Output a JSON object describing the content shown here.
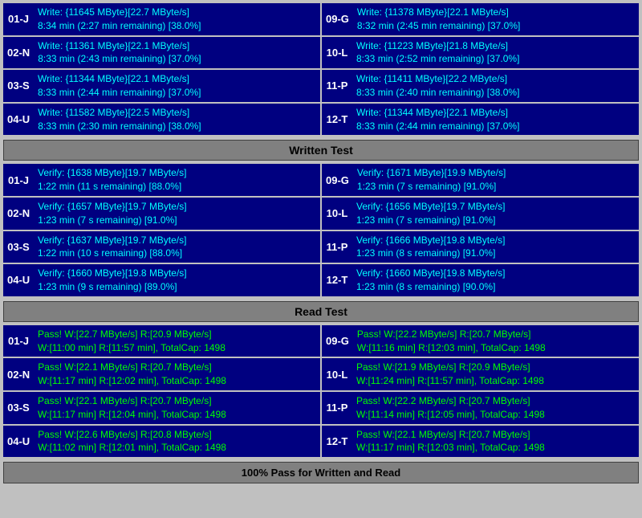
{
  "written_test": {
    "label": "Written Test",
    "rows_left": [
      {
        "id": "01-J",
        "line1": "Write: {11645 MByte}[22.7 MByte/s]",
        "line2": "8:34 min (2:27 min remaining)  [38.0%]"
      },
      {
        "id": "02-N",
        "line1": "Write: {11361 MByte}[22.1 MByte/s]",
        "line2": "8:33 min (2:43 min remaining)  [37.0%]"
      },
      {
        "id": "03-S",
        "line1": "Write: {11344 MByte}[22.1 MByte/s]",
        "line2": "8:33 min (2:44 min remaining)  [37.0%]"
      },
      {
        "id": "04-U",
        "line1": "Write: {11582 MByte}[22.5 MByte/s]",
        "line2": "8:33 min (2:30 min remaining)  [38.0%]"
      }
    ],
    "rows_right": [
      {
        "id": "09-G",
        "line1": "Write: {11378 MByte}[22.1 MByte/s]",
        "line2": "8:32 min (2:45 min remaining)  [37.0%]"
      },
      {
        "id": "10-L",
        "line1": "Write: {11223 MByte}[21.8 MByte/s]",
        "line2": "8:33 min (2:52 min remaining)  [37.0%]"
      },
      {
        "id": "11-P",
        "line1": "Write: {11411 MByte}[22.2 MByte/s]",
        "line2": "8:33 min (2:40 min remaining)  [38.0%]"
      },
      {
        "id": "12-T",
        "line1": "Write: {11344 MByte}[22.1 MByte/s]",
        "line2": "8:33 min (2:44 min remaining)  [37.0%]"
      }
    ]
  },
  "verify_test": {
    "label": "Written Test",
    "rows_left": [
      {
        "id": "01-J",
        "line1": "Verify: {1638 MByte}[19.7 MByte/s]",
        "line2": "1:22 min (11 s remaining)  [88.0%]"
      },
      {
        "id": "02-N",
        "line1": "Verify: {1657 MByte}[19.7 MByte/s]",
        "line2": "1:23 min (7 s remaining)  [91.0%]"
      },
      {
        "id": "03-S",
        "line1": "Verify: {1637 MByte}[19.7 MByte/s]",
        "line2": "1:22 min (10 s remaining)  [88.0%]"
      },
      {
        "id": "04-U",
        "line1": "Verify: {1660 MByte}[19.8 MByte/s]",
        "line2": "1:23 min (9 s remaining)  [89.0%]"
      }
    ],
    "rows_right": [
      {
        "id": "09-G",
        "line1": "Verify: {1671 MByte}[19.9 MByte/s]",
        "line2": "1:23 min (7 s remaining)  [91.0%]"
      },
      {
        "id": "10-L",
        "line1": "Verify: {1656 MByte}[19.7 MByte/s]",
        "line2": "1:23 min (7 s remaining)  [91.0%]"
      },
      {
        "id": "11-P",
        "line1": "Verify: {1666 MByte}[19.8 MByte/s]",
        "line2": "1:23 min (8 s remaining)  [91.0%]"
      },
      {
        "id": "12-T",
        "line1": "Verify: {1660 MByte}[19.8 MByte/s]",
        "line2": "1:23 min (8 s remaining)  [90.0%]"
      }
    ]
  },
  "read_test": {
    "label": "Read Test",
    "rows_left": [
      {
        "id": "01-J",
        "line1": "Pass! W:[22.7 MByte/s] R:[20.9 MByte/s]",
        "line2": "W:[11:00 min] R:[11:57 min], TotalCap: 1498"
      },
      {
        "id": "02-N",
        "line1": "Pass! W:[22.1 MByte/s] R:[20.7 MByte/s]",
        "line2": "W:[11:17 min] R:[12:02 min], TotalCap: 1498"
      },
      {
        "id": "03-S",
        "line1": "Pass! W:[22.1 MByte/s] R:[20.7 MByte/s]",
        "line2": "W:[11:17 min] R:[12:04 min], TotalCap: 1498"
      },
      {
        "id": "04-U",
        "line1": "Pass! W:[22.6 MByte/s] R:[20.8 MByte/s]",
        "line2": "W:[11:02 min] R:[12:01 min], TotalCap: 1498"
      }
    ],
    "rows_right": [
      {
        "id": "09-G",
        "line1": "Pass! W:[22.2 MByte/s] R:[20.7 MByte/s]",
        "line2": "W:[11:16 min] R:[12:03 min], TotalCap: 1498"
      },
      {
        "id": "10-L",
        "line1": "Pass! W:[21.9 MByte/s] R:[20.9 MByte/s]",
        "line2": "W:[11:24 min] R:[11:57 min], TotalCap: 1498"
      },
      {
        "id": "11-P",
        "line1": "Pass! W:[22.2 MByte/s] R:[20.7 MByte/s]",
        "line2": "W:[11:14 min] R:[12:05 min], TotalCap: 1498"
      },
      {
        "id": "12-T",
        "line1": "Pass! W:[22.1 MByte/s] R:[20.7 MByte/s]",
        "line2": "W:[11:17 min] R:[12:03 min], TotalCap: 1498"
      }
    ]
  },
  "status": {
    "label": "100% Pass for Written and Read"
  }
}
